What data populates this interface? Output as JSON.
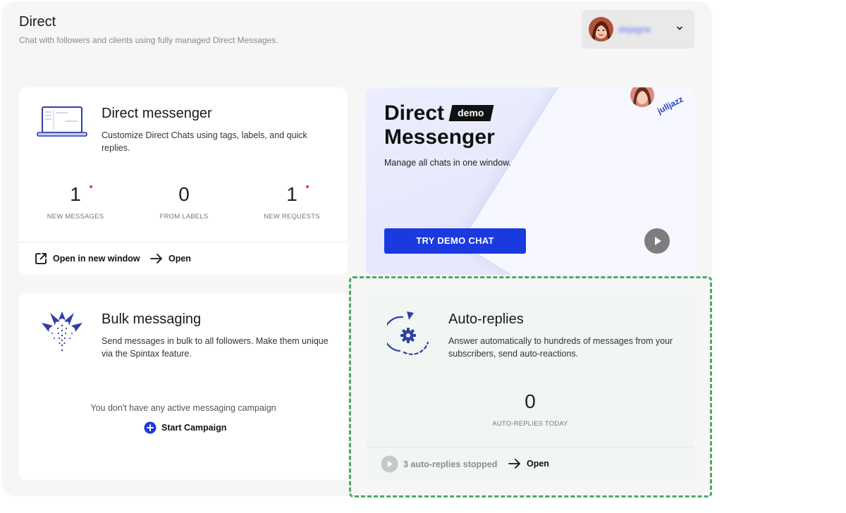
{
  "header": {
    "title": "Direct",
    "subtitle": "Chat with followers and clients using fully managed Direct Messages."
  },
  "account": {
    "username": "dejagne"
  },
  "direct_messenger": {
    "title": "Direct messenger",
    "description": "Customize Direct Chats using tags, labels, and quick replies.",
    "stats": [
      {
        "value": "1",
        "label": "NEW MESSAGES",
        "unread": true
      },
      {
        "value": "0",
        "label": "FROM LABELS",
        "unread": false
      },
      {
        "value": "1",
        "label": "NEW REQUESTS",
        "unread": true
      }
    ],
    "open_new_window_label": "Open in new window",
    "open_label": "Open"
  },
  "demo": {
    "title_line1": "Direct",
    "badge": "demo",
    "title_line2": "Messenger",
    "subtitle": "Manage all chats in one window.",
    "button_label": "TRY DEMO CHAT",
    "preview_username": "julljazz"
  },
  "bulk": {
    "title": "Bulk messaging",
    "description": "Send messages in bulk to all followers. Make them unique via the Spintax feature.",
    "empty_text": "You don't have any active messaging campaign",
    "start_label": "Start Campaign"
  },
  "auto_replies": {
    "title": "Auto-replies",
    "description": "Answer automatically to hundreds of messages from your subscribers, send auto-reactions.",
    "count": "0",
    "count_label": "AUTO-REPLIES TODAY",
    "stopped_label": "3 auto-replies stopped",
    "open_label": "Open"
  },
  "colors": {
    "accent_blue": "#1a3ae0",
    "unread_dot": "#e0402f",
    "highlight_green": "#4ea866",
    "icon_blue": "#2f3fa8"
  }
}
